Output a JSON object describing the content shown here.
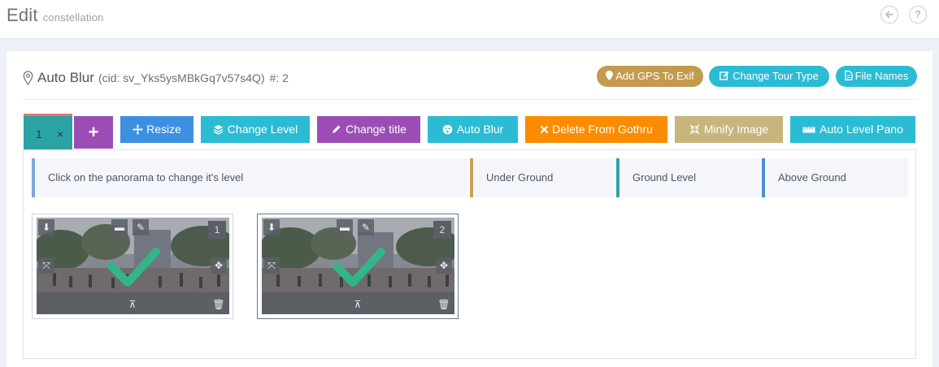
{
  "page": {
    "title": "Edit",
    "subtitle": "constellation"
  },
  "header_icons": {
    "back": "arrow-left-circle-icon",
    "help": "question-circle-icon",
    "help_glyph": "?"
  },
  "card": {
    "title": "Auto Blur",
    "cid": "(cid: sv_Yks5ysMBkGq7v57s4Q)",
    "count": "#: 2",
    "pills": [
      {
        "label": "Add GPS To Exif",
        "color": "#c39a4e"
      },
      {
        "label": "Change Tour Type",
        "color": "#2bbcd4"
      },
      {
        "label": "File Names",
        "color": "#2bbcd4"
      }
    ]
  },
  "tabs": {
    "active_label": "1",
    "close_glyph": "×",
    "add_glyph": "+"
  },
  "toolbar": [
    {
      "label": "Resize",
      "color": "#3d8fe0",
      "icon": "move-arrows-icon"
    },
    {
      "label": "Change Level",
      "color": "#2bbcd4",
      "icon": "layers-icon"
    },
    {
      "label": "Change title",
      "color": "#9c4db5",
      "icon": "pencil-icon"
    },
    {
      "label": "Auto Blur",
      "color": "#2bbcd4",
      "icon": "face-blur-icon"
    },
    {
      "label": "Delete From Gothru",
      "color": "#fb8c00",
      "icon": "times-icon"
    },
    {
      "label": "Minify Image",
      "color": "#c8b47d",
      "icon": "compress-icon"
    },
    {
      "label": "Auto Level Pano",
      "color": "#2bbcd4",
      "icon": "ruler-icon"
    }
  ],
  "info_bar": {
    "message": "Click on the panorama to change it's level",
    "levels": [
      {
        "label": "Under Ground",
        "color": "#c9a15a"
      },
      {
        "label": "Ground Level",
        "color": "#2aa5a0"
      },
      {
        "label": "Above Ground",
        "color": "#4a8fd6"
      }
    ],
    "message_color": "#7fa6d8"
  },
  "thumbnails": [
    {
      "number": "1"
    },
    {
      "number": "2"
    }
  ]
}
